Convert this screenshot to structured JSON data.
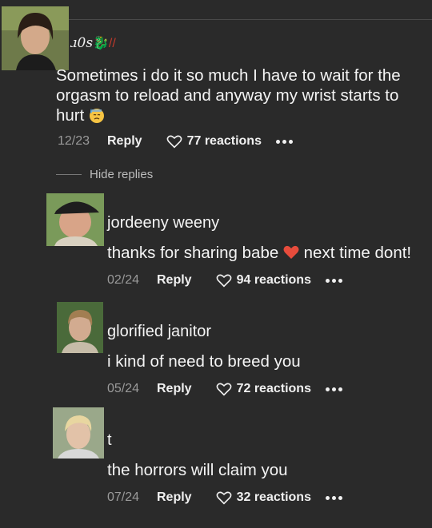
{
  "top_comment": {
    "username": "ɹ0s",
    "text_line1": "Sometimes i do it so much I have to wait for the",
    "text_line2": "orgasm to reload and anyway my wrist starts to",
    "text_line3": "hurt",
    "date": "12/23",
    "reply_label": "Reply",
    "reactions": "77 reactions"
  },
  "hide_replies_label": "Hide replies",
  "replies": [
    {
      "username": "jordeeny weeny",
      "text_before": "thanks for sharing babe",
      "text_after": "next time dont!",
      "date": "02/24",
      "reply_label": "Reply",
      "reactions": "94 reactions"
    },
    {
      "username": "glorified janitor",
      "text": "i kind of need to breed you",
      "date": "05/24",
      "reply_label": "Reply",
      "reactions": "72 reactions"
    },
    {
      "username": "t",
      "text": "the horrors will claim you",
      "date": "07/24",
      "reply_label": "Reply",
      "reactions": "32 reactions"
    }
  ]
}
